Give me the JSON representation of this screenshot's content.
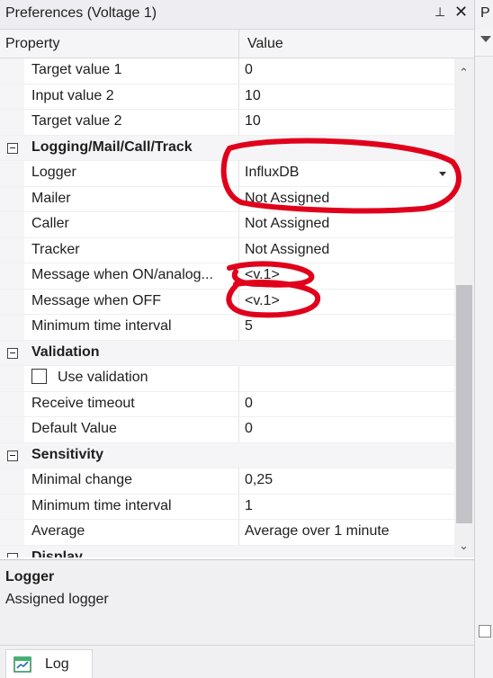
{
  "window": {
    "title": "Preferences (Voltage 1)",
    "pin_glyph": "⊥",
    "close_glyph": "✕"
  },
  "right_panel": {
    "letter": "P"
  },
  "grid": {
    "header": {
      "property": "Property",
      "value": "Value"
    },
    "rows": [
      {
        "kind": "item",
        "property": "Target value 1",
        "value": "0"
      },
      {
        "kind": "item",
        "property": "Input value 2",
        "value": "10"
      },
      {
        "kind": "item",
        "property": "Target value 2",
        "value": "10"
      },
      {
        "kind": "category",
        "property": "Logging/Mail/Call/Track",
        "value": ""
      },
      {
        "kind": "item",
        "property": "Logger",
        "value": "InfluxDB",
        "dropdown": true
      },
      {
        "kind": "item",
        "property": "Mailer",
        "value": "Not Assigned"
      },
      {
        "kind": "item",
        "property": "Caller",
        "value": "Not Assigned"
      },
      {
        "kind": "item",
        "property": "Tracker",
        "value": "Not Assigned"
      },
      {
        "kind": "item",
        "property": "Message when ON/analog...",
        "value": "<v.1>"
      },
      {
        "kind": "item",
        "property": "Message when OFF",
        "value": "<v.1>"
      },
      {
        "kind": "item",
        "property": "Minimum time interval",
        "value": "5"
      },
      {
        "kind": "category",
        "property": "Validation",
        "value": ""
      },
      {
        "kind": "checkbox",
        "property": "Use validation",
        "value": "",
        "checked": false
      },
      {
        "kind": "item",
        "property": "Receive timeout",
        "value": "0"
      },
      {
        "kind": "item",
        "property": "Default Value",
        "value": "0"
      },
      {
        "kind": "category",
        "property": "Sensitivity",
        "value": ""
      },
      {
        "kind": "item",
        "property": "Minimal change",
        "value": "0,25"
      },
      {
        "kind": "item",
        "property": "Minimum time interval",
        "value": "1"
      },
      {
        "kind": "item",
        "property": "Average",
        "value": "Average over 1 minute"
      },
      {
        "kind": "category",
        "property": "Display",
        "value": ""
      }
    ]
  },
  "scrollbar": {
    "up_glyph": "⌃",
    "down_glyph": "⌄"
  },
  "description": {
    "title": "Logger",
    "text": "Assigned logger"
  },
  "bottom_tabs": [
    {
      "label": "Log",
      "icon": "log-icon"
    }
  ],
  "colors": {
    "annotation": "#e0001b",
    "panel_bg": "#f0f0f2",
    "category_bg": "#f5f5f7"
  }
}
